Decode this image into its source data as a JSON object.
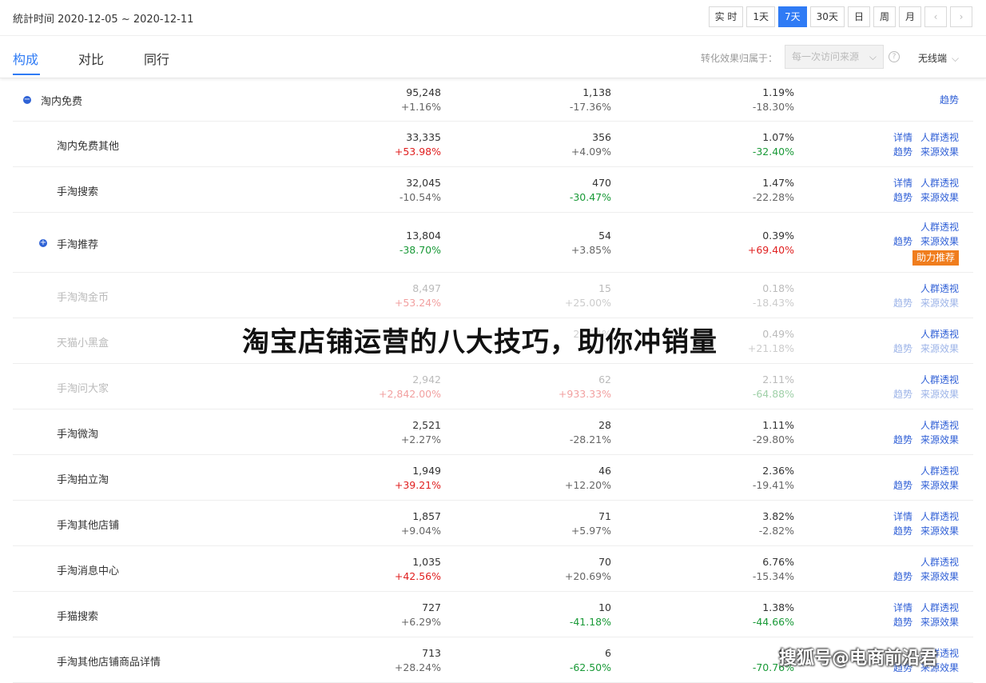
{
  "header": {
    "stat_time": "統計时间 2020-12-05 ~ 2020-12-11",
    "periods": [
      "实 时",
      "1天",
      "7天",
      "30天",
      "日",
      "周",
      "月"
    ],
    "active_period": "7天",
    "prev_arrow": "‹",
    "next_arrow": "›"
  },
  "tabs": [
    "构成",
    "对比",
    "同行"
  ],
  "active_tab": "构成",
  "attribution": {
    "label": "转化效果归属于：",
    "value": "每一次访问来源",
    "device": "无线端",
    "help": "?",
    "chevron": "⌵"
  },
  "rows": [
    {
      "name": "淘内免费",
      "expand": "−",
      "c1": "95,248",
      "c1chg": "+1.16%",
      "c1dir": "",
      "c2": "1,138",
      "c2chg": "-17.36%",
      "c2dir": "",
      "c3": "1.19%",
      "c3chg": "-18.30%",
      "c3dir": "",
      "ops1": [
        "趋势"
      ],
      "ops2": []
    },
    {
      "name": "淘内免费其他",
      "c1": "33,335",
      "c1chg": "+53.98%",
      "c1dir": "up",
      "c2": "356",
      "c2chg": "+4.09%",
      "c2dir": "",
      "c3": "1.07%",
      "c3chg": "-32.40%",
      "c3dir": "down",
      "ops1": [
        "详情",
        "人群透视"
      ],
      "ops2": [
        "趋势",
        "来源效果"
      ]
    },
    {
      "name": "手淘搜索",
      "c1": "32,045",
      "c1chg": "-10.54%",
      "c1dir": "",
      "c2": "470",
      "c2chg": "-30.47%",
      "c2dir": "down",
      "c3": "1.47%",
      "c3chg": "-22.28%",
      "c3dir": "",
      "ops1": [
        "详情",
        "人群透视"
      ],
      "ops2": [
        "趋势",
        "来源效果"
      ]
    },
    {
      "name": "手淘推荐",
      "expand": "+",
      "c1": "13,804",
      "c1chg": "-38.70%",
      "c1dir": "down",
      "c2": "54",
      "c2chg": "+3.85%",
      "c2dir": "",
      "c3": "0.39%",
      "c3chg": "+69.40%",
      "c3dir": "up",
      "ops1": [
        "人群透视"
      ],
      "ops2": [
        "趋势",
        "来源效果"
      ],
      "badge": "助力推荐"
    },
    {
      "name": "手淘淘金币",
      "dim": true,
      "c1": "8,497",
      "c1chg": "+53.24%",
      "c1dir": "up",
      "c2": "15",
      "c2chg": "+25.00%",
      "c2dir": "",
      "c3": "0.18%",
      "c3chg": "-18.43%",
      "c3dir": "",
      "ops1": [
        "人群透视"
      ],
      "ops2": [
        "趋势",
        "来源效果"
      ]
    },
    {
      "name": "天猫小黑盒",
      "dim": true,
      "c1": "",
      "c1chg": "",
      "c1dir": "",
      "c2": "",
      "c2chg": "24.24%",
      "c2dir": "",
      "c3": "0.49%",
      "c3chg": "+21.18%",
      "c3dir": "",
      "ops1": [
        "人群透视"
      ],
      "ops2": [
        "趋势",
        "来源效果"
      ]
    },
    {
      "name": "手淘问大家",
      "dim": true,
      "c1": "2,942",
      "c1chg": "+2,842.00%",
      "c1dir": "up",
      "c2": "62",
      "c2chg": "+933.33%",
      "c2dir": "up",
      "c3": "2.11%",
      "c3chg": "-64.88%",
      "c3dir": "down",
      "ops1": [
        "人群透视"
      ],
      "ops2": [
        "趋势",
        "来源效果"
      ]
    },
    {
      "name": "手淘微淘",
      "c1": "2,521",
      "c1chg": "+2.27%",
      "c1dir": "",
      "c2": "28",
      "c2chg": "-28.21%",
      "c2dir": "",
      "c3": "1.11%",
      "c3chg": "-29.80%",
      "c3dir": "",
      "ops1": [
        "人群透视"
      ],
      "ops2": [
        "趋势",
        "来源效果"
      ]
    },
    {
      "name": "手淘拍立淘",
      "c1": "1,949",
      "c1chg": "+39.21%",
      "c1dir": "up",
      "c2": "46",
      "c2chg": "+12.20%",
      "c2dir": "",
      "c3": "2.36%",
      "c3chg": "-19.41%",
      "c3dir": "",
      "ops1": [
        "人群透视"
      ],
      "ops2": [
        "趋势",
        "来源效果"
      ]
    },
    {
      "name": "手淘其他店铺",
      "c1": "1,857",
      "c1chg": "+9.04%",
      "c1dir": "",
      "c2": "71",
      "c2chg": "+5.97%",
      "c2dir": "",
      "c3": "3.82%",
      "c3chg": "-2.82%",
      "c3dir": "",
      "ops1": [
        "详情",
        "人群透视"
      ],
      "ops2": [
        "趋势",
        "来源效果"
      ]
    },
    {
      "name": "手淘消息中心",
      "c1": "1,035",
      "c1chg": "+42.56%",
      "c1dir": "up",
      "c2": "70",
      "c2chg": "+20.69%",
      "c2dir": "",
      "c3": "6.76%",
      "c3chg": "-15.34%",
      "c3dir": "",
      "ops1": [
        "人群透视"
      ],
      "ops2": [
        "趋势",
        "来源效果"
      ]
    },
    {
      "name": "手猫搜索",
      "c1": "727",
      "c1chg": "+6.29%",
      "c1dir": "",
      "c2": "10",
      "c2chg": "-41.18%",
      "c2dir": "down",
      "c3": "1.38%",
      "c3chg": "-44.66%",
      "c3dir": "down",
      "ops1": [
        "详情",
        "人群透视"
      ],
      "ops2": [
        "趋势",
        "来源效果"
      ]
    },
    {
      "name": "手淘其他店铺商品详情",
      "c1": "713",
      "c1chg": "+28.24%",
      "c1dir": "",
      "c2": "6",
      "c2chg": "-62.50%",
      "c2dir": "down",
      "c3": "0.8",
      "c3chg": "-70.76%",
      "c3dir": "down",
      "ops1": [
        "人群透视"
      ],
      "ops2": [
        "趋势",
        "来源效果"
      ]
    }
  ],
  "overlay_title": "淘宝店铺运营的八大技巧，助你冲销量",
  "watermark": "搜狐号@电商前沿君"
}
